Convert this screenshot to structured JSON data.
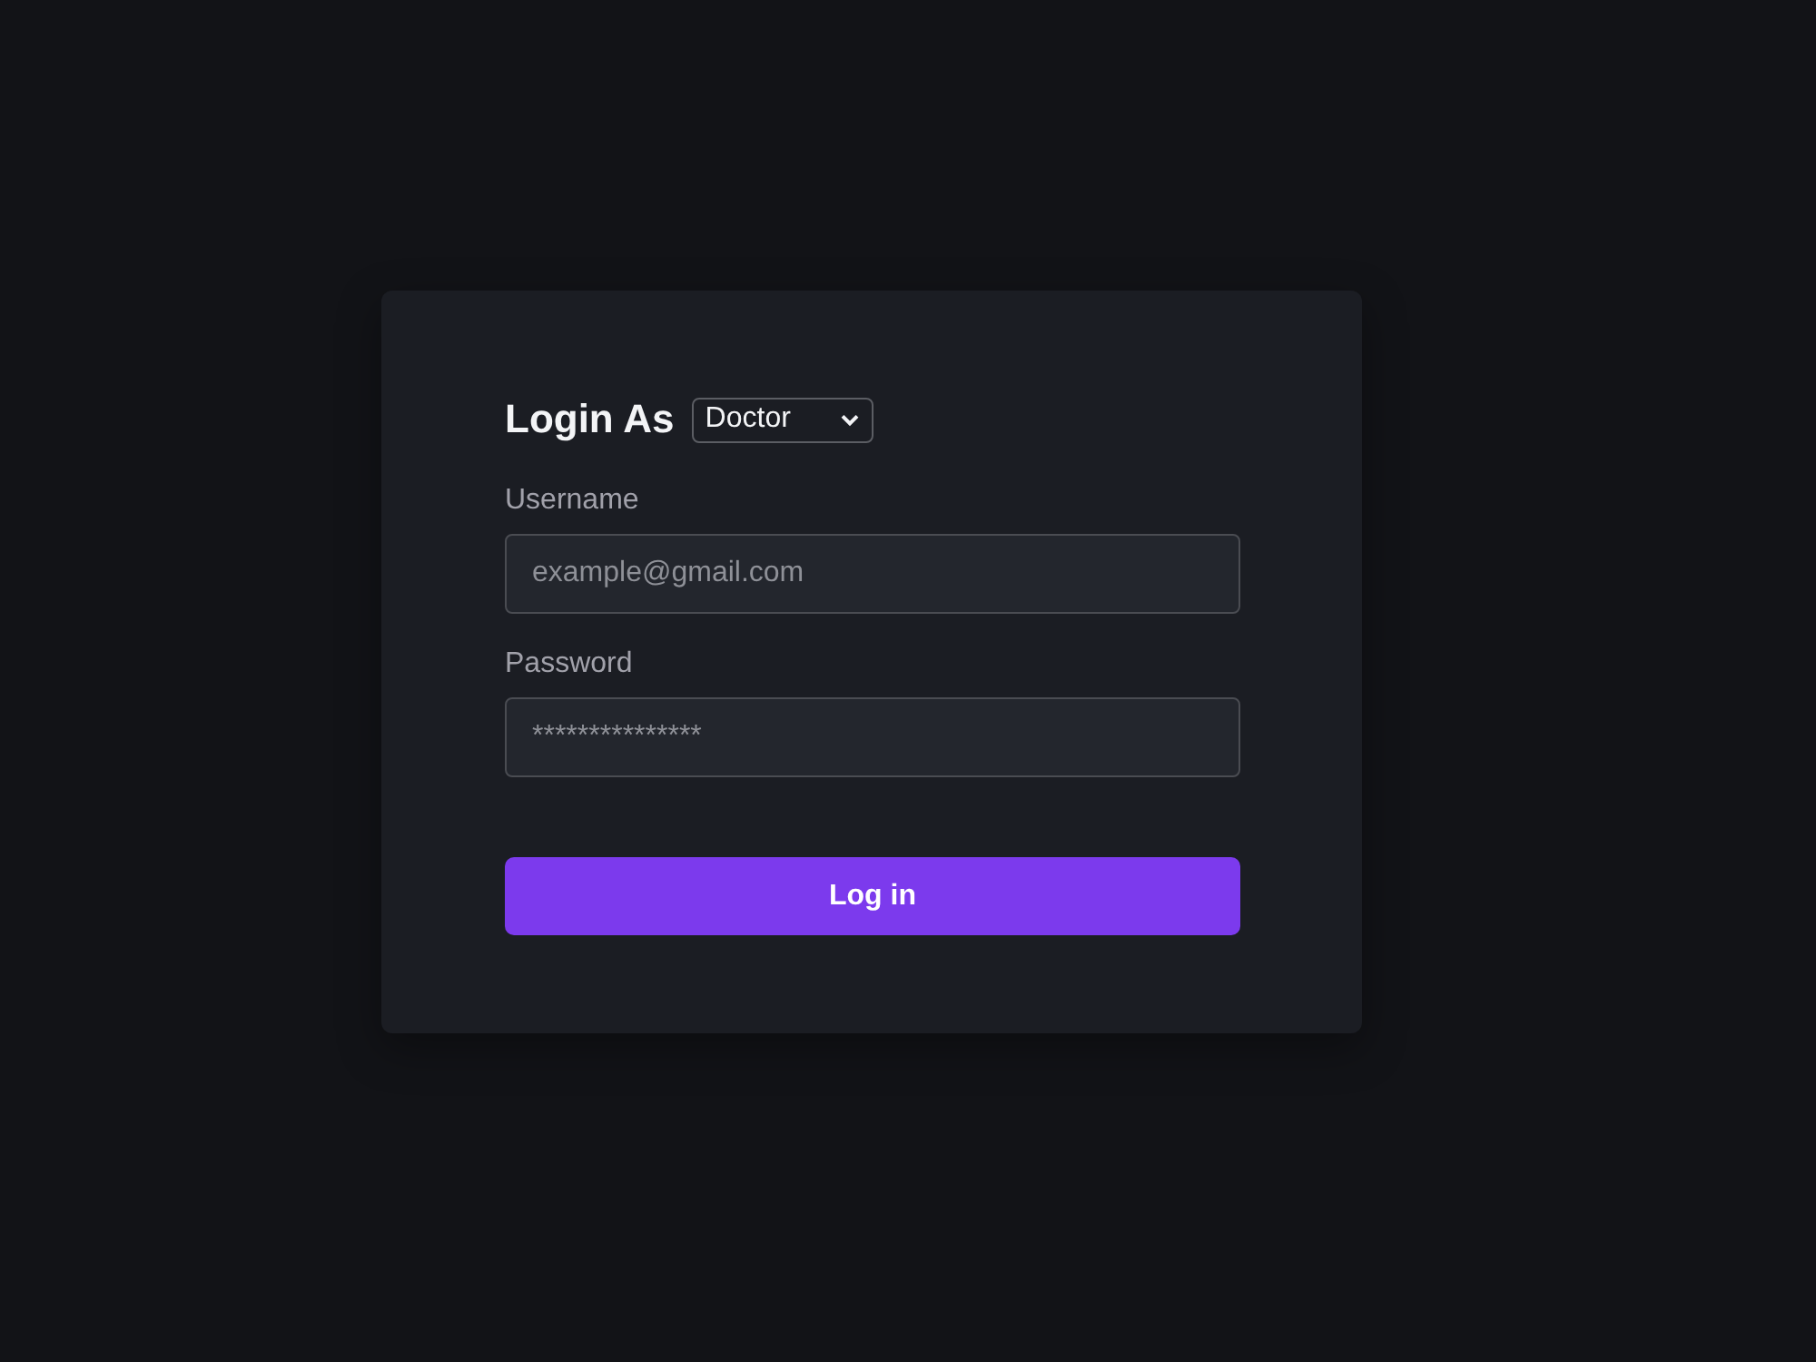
{
  "login_card": {
    "title": "Login As",
    "role_select": {
      "value": "Doctor"
    },
    "fields": [
      {
        "label": "Username",
        "placeholder": "example@gmail.com"
      },
      {
        "label": "Password",
        "placeholder": "***************"
      }
    ],
    "submit_button": "Log in"
  }
}
